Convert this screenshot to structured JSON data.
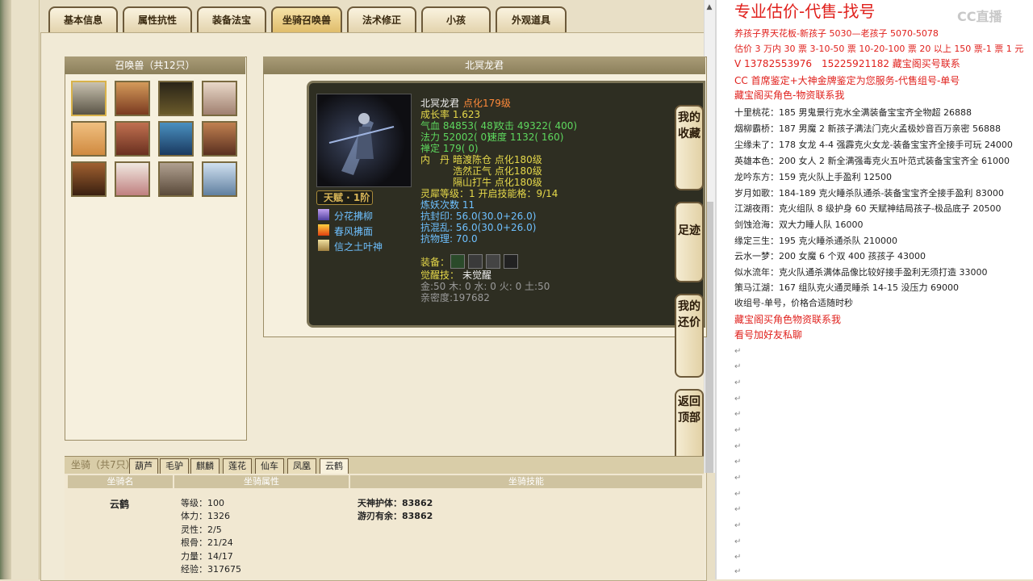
{
  "tabs": [
    "基本信息",
    "属性抗性",
    "装备法宝",
    "坐骑召唤兽",
    "法术修正",
    "小孩",
    "外观道具"
  ],
  "summon": {
    "header": "召唤兽（共12只）"
  },
  "detail": {
    "header": "北冥龙君",
    "name": "北冥龙君",
    "name_badge": "点化179级",
    "growth": "成长率 1.623",
    "hp": "气血 84853( 48)",
    "atk": "攻击 49322( 400)",
    "mp": "法力 52002( 0)",
    "spd": "速度 1132( 160)",
    "zen": "禅定 179( 0)",
    "neidan_label": "内　丹",
    "neidan": [
      "暗渡陈仓 点化180级",
      "浩然正气 点化180级",
      "隔山打牛 点化180级"
    ],
    "talent": "天赋 · 1阶",
    "skills": [
      "分花拂柳",
      "春风拂面",
      "信之土叶神"
    ],
    "rune": "灵犀等级：1 开启技能格：9/14",
    "refine": "炼妖次数 11",
    "res1": "抗封印: 56.0(30.0+26.0)",
    "res2": "抗混乱: 56.0(30.0+26.0)",
    "res3": "抗物理: 70.0",
    "equip_label": "装备：",
    "awaken_label": "觉醒技：",
    "awaken_value": "未觉醒",
    "elements": "金:50 木: 0 水: 0 火: 0 土:50",
    "intimacy": "亲密度:197682"
  },
  "side_buttons": [
    "我的收藏",
    "足迹",
    "我的还价",
    "返回顶部"
  ],
  "mount": {
    "header": "坐骑（共7只）",
    "tabs": [
      "葫芦",
      "毛驴",
      "麒麟",
      "莲花",
      "仙车",
      "凤凰",
      "云鹤"
    ],
    "col_name": "坐骑名",
    "col_attr": "坐骑属性",
    "col_skill": "坐骑技能",
    "name": "云鹤",
    "attrs": [
      "等级：100",
      "体力：1326",
      "灵性：2/5",
      "根骨：21/24",
      "力量：14/17",
      "经验：317675"
    ],
    "skills": [
      "天神护体：83862",
      "游刃有余：83862"
    ]
  },
  "right": {
    "title": "专业估价-代售-找号",
    "lines_red": [
      "养孩子界天花板-新孩子 5030—老孩子 5070-5078",
      "估价 3 万内 30 票 3-10-50 票 10-20-100 票 20 以上 150 票-1 票 1 元",
      "V 13782553976　15225921182 藏宝阁买号联系",
      "CC 首席鉴定+大神金牌鉴定为您服务-代售组号-单号",
      "藏宝阁买角色-物资联系我"
    ],
    "listings": [
      "十里桃花：185 男鬼景行克水全满装备宝宝齐全物超 26888",
      "烟柳霸桥：187 男魔 2 新孩子满法门克火孟极妙音百万亲密 56888",
      "尘缘未了：178 女龙 4-4 强霹克火女龙-装备宝宝齐全接手可玩 24000",
      "英雄本色：200 女人 2 新全满强毒克火五叶范式装备宝宝齐全 61000",
      "龙吟东方：159 克火队上手盈利 12500",
      "岁月如歌：184-189 克火睡杀队通杀-装备宝宝齐全接手盈利 83000",
      "江湖夜雨：克火组队 8 级护身 60 天赋神结局孩子-极品底子 20500",
      "剑蚀沧海：双大力睡人队 16000",
      "缘定三生：195 克火睡杀通杀队 210000",
      "云水一梦：200 女魔 6 个双 400 孩孩子 43000",
      "似水流年：克火队通杀满体品像比较好接手盈利无须打造 33000",
      "策马江湖：167 组队克火通灵睡杀 14-15 没压力 69000",
      "收组号-单号，价格合适随时秒"
    ],
    "footer_red": [
      "藏宝阁买角色物资联系我",
      "看号加好友私聊"
    ],
    "watermark": "CC直播"
  }
}
